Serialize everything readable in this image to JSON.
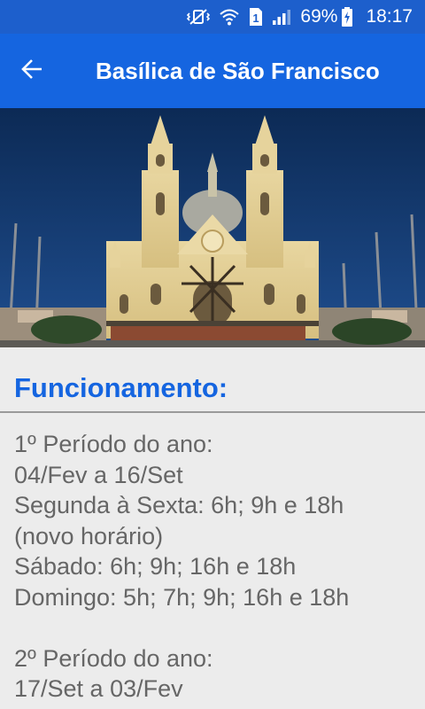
{
  "status_bar": {
    "battery": "69%",
    "time": "18:17",
    "sim_slot": "1",
    "icons": [
      "vibrate-mute-icon",
      "wifi-icon",
      "sim-1-icon",
      "signal-icon",
      "battery-charging-icon"
    ]
  },
  "app_bar": {
    "title": "Basílica de São Francisco",
    "back_icon": "arrow-back-icon"
  },
  "hero": {
    "description_icon": "church-photo"
  },
  "section": {
    "title": "Funcionamento:"
  },
  "schedule": {
    "period1_title": "1º Período do ano:",
    "period1_dates": "04/Fev a 16/Set",
    "period1_weekdays": "Segunda à Sexta: 6h; 9h e 18h",
    "period1_note": "(novo horário)",
    "period1_saturday": "Sábado: 6h; 9h; 16h e 18h",
    "period1_sunday": "Domingo: 5h; 7h; 9h; 16h e 18h",
    "period2_title": "2º Período do ano:",
    "period2_dates": "17/Set a 03/Fev"
  },
  "colors": {
    "status_bar": "#1d5fcc",
    "app_bar": "#1565e0",
    "accent": "#1565e0",
    "body_text": "#666666",
    "background": "#ececec"
  }
}
